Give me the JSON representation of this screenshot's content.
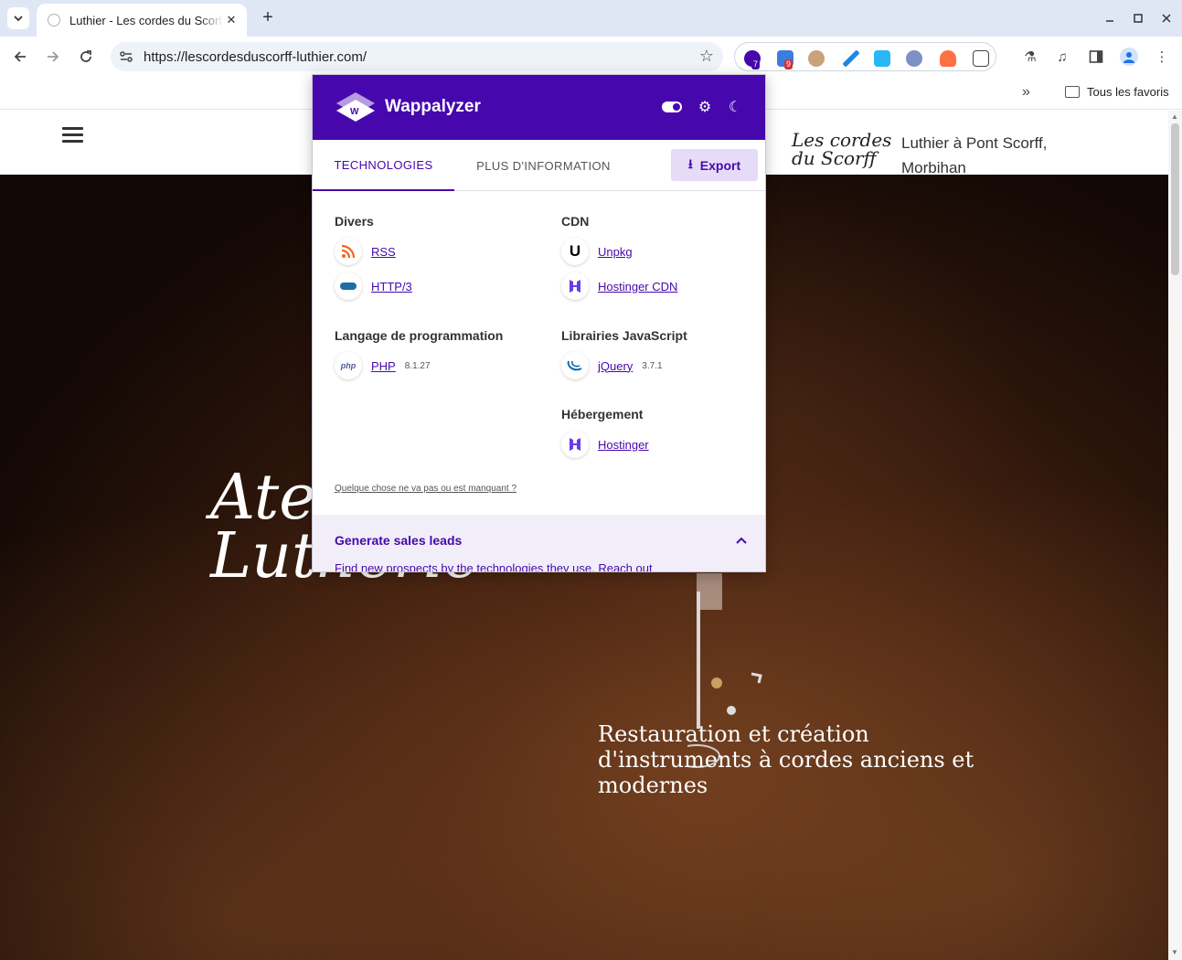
{
  "browser": {
    "tab_title": "Luthier - Les cordes du Scorff",
    "url": "https://lescordesduscorff-luthier.com/",
    "extension_badges": {
      "wappalyzer": "7",
      "second": "9"
    },
    "bookmarks_folder": "Tous les favoris"
  },
  "site": {
    "logo_line1": "Les cordes",
    "logo_line2": "du Scorff",
    "tagline": "Luthier à Pont Scorff, Morbihan",
    "hero_title_line1": "Atelier",
    "hero_title_line2": "Lutherie",
    "hero_subtitle": "Restauration et création d'instruments à cordes anciens et modernes"
  },
  "wappalyzer": {
    "brand": "Wappalyzer",
    "tabs": {
      "technologies": "TECHNOLOGIES",
      "more_info": "PLUS D'INFORMATION"
    },
    "export_label": "Export",
    "categories": {
      "divers": {
        "title": "Divers",
        "items": [
          {
            "name": "RSS"
          },
          {
            "name": "HTTP/3"
          }
        ]
      },
      "cdn": {
        "title": "CDN",
        "items": [
          {
            "name": "Unpkg"
          },
          {
            "name": "Hostinger CDN"
          }
        ]
      },
      "lang": {
        "title": "Langage de programmation",
        "items": [
          {
            "name": "PHP",
            "version": "8.1.27"
          }
        ]
      },
      "js": {
        "title": "Librairies JavaScript",
        "items": [
          {
            "name": "jQuery",
            "version": "3.7.1"
          }
        ]
      },
      "hosting": {
        "title": "Hébergement",
        "items": [
          {
            "name": "Hostinger"
          }
        ]
      }
    },
    "issue_link": "Quelque chose ne va pas ou est manquant ?",
    "leads_title": "Generate sales leads",
    "leads_text": "Find new prospects by the technologies they use. Reach out"
  },
  "colors": {
    "brand": "#4608ad",
    "rss": "#f26522",
    "hostinger": "#673de6"
  },
  "icons": {
    "rss": "rss-icon",
    "http3": "http3-icon",
    "unpkg": "unpkg-icon",
    "hostinger_cdn": "hostinger-icon",
    "php": "php-icon",
    "jquery": "jquery-icon",
    "hostinger": "hostinger-icon"
  }
}
